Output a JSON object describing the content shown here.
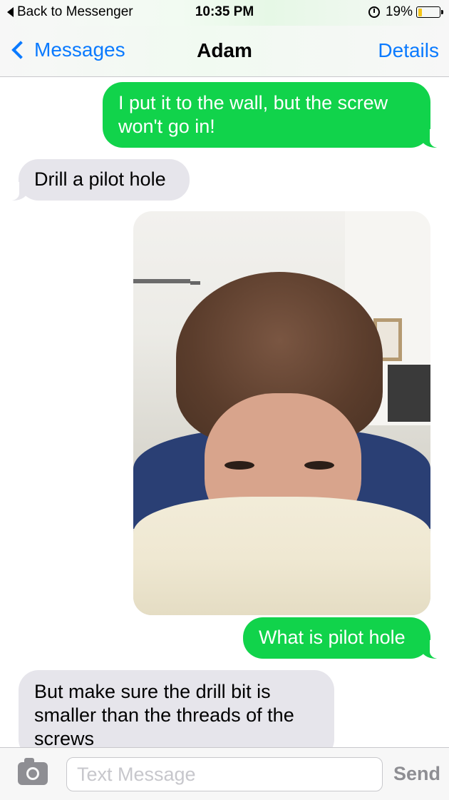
{
  "status_bar": {
    "back_app_label": "Back to Messenger",
    "time": "10:35 PM",
    "battery_text": "19%",
    "battery_level": 0.19,
    "battery_color": "#f5c518",
    "alarm_icon": "alarm-clock-icon"
  },
  "nav": {
    "back_label": "Messages",
    "title": "Adam",
    "details_label": "Details",
    "accent_color": "#0a7aff"
  },
  "messages": [
    {
      "direction": "sent",
      "text": "I put it to the wall, but the screw won't go in!"
    },
    {
      "direction": "received",
      "text": "Drill a pilot hole"
    },
    {
      "direction": "sent",
      "type": "photo"
    },
    {
      "direction": "sent",
      "text": "What is pilot hole"
    },
    {
      "direction": "received",
      "text": "But make sure the drill bit is smaller than the threads of the screws"
    }
  ],
  "colors": {
    "sent_bubble": "#11d34b",
    "received_bubble": "#e6e5eb"
  },
  "composer": {
    "camera_icon": "camera-icon",
    "placeholder": "Text Message",
    "value": "",
    "send_label": "Send"
  }
}
